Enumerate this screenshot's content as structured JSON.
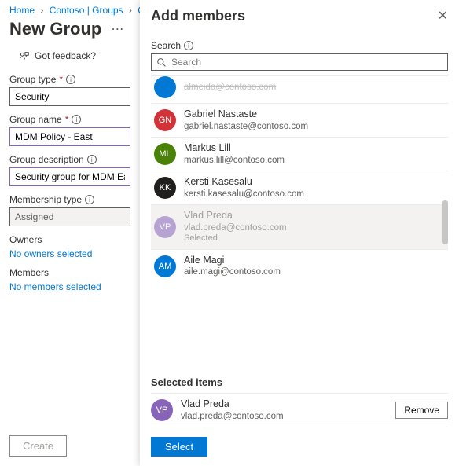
{
  "breadcrumb": {
    "items": [
      "Home",
      "Contoso | Groups",
      "Gr"
    ]
  },
  "page": {
    "title": "New Group"
  },
  "feedback": {
    "label": "Got feedback?"
  },
  "form": {
    "group_type": {
      "label": "Group type",
      "value": "Security"
    },
    "group_name": {
      "label": "Group name",
      "value": "MDM Policy - East"
    },
    "group_desc": {
      "label": "Group description",
      "value": "Security group for MDM East"
    },
    "membership_type": {
      "label": "Membership type",
      "value": "Assigned"
    },
    "owners": {
      "label": "Owners",
      "link": "No owners selected"
    },
    "members": {
      "label": "Members",
      "link": "No members selected"
    },
    "create_btn": "Create"
  },
  "panel": {
    "title": "Add members",
    "search": {
      "label": "Search",
      "placeholder": "Search"
    },
    "results": [
      {
        "initials": "GN",
        "color": "#d13438",
        "name": "Gabriel Nastaste",
        "email": "gabriel.nastaste@contoso.com"
      },
      {
        "initials": "ML",
        "color": "#498205",
        "name": "Markus Lill",
        "email": "markus.lill@contoso.com"
      },
      {
        "initials": "KK",
        "color": "#201f1e",
        "name": "Kersti Kasesalu",
        "email": "kersti.kasesalu@contoso.com"
      },
      {
        "initials": "VP",
        "color": "#8764b8",
        "name": "Vlad Preda",
        "email": "vlad.preda@contoso.com",
        "selected_label": "Selected"
      },
      {
        "initials": "AM",
        "color": "#0078d4",
        "name": "Aile Magi",
        "email": "aile.magi@contoso.com"
      }
    ],
    "partial_above": {
      "email_fragment": "…@contoso.com",
      "color": "#0078d4"
    },
    "selected_header": "Selected items",
    "selected_items": [
      {
        "initials": "VP",
        "color": "#8764b8",
        "name": "Vlad Preda",
        "email": "vlad.preda@contoso.com"
      }
    ],
    "remove_btn": "Remove",
    "select_btn": "Select"
  }
}
